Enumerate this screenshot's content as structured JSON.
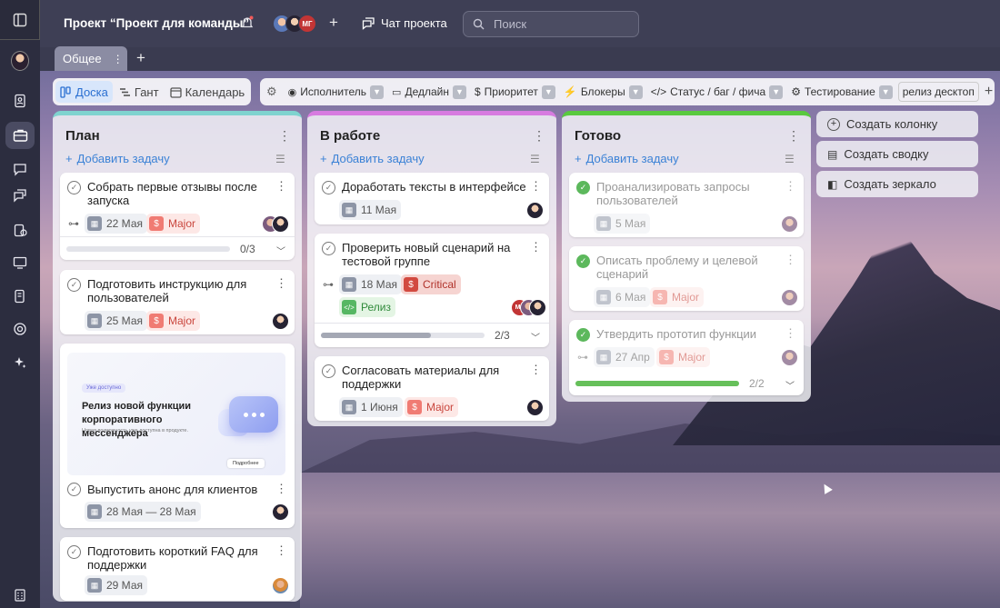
{
  "header": {
    "title": "Проект “Проект для команды”",
    "member_badge": "МГ",
    "chat_label": "Чат проекта",
    "search_placeholder": "Поиск"
  },
  "tabs": {
    "general": "Общее"
  },
  "views": [
    {
      "label": "Доска",
      "active": true
    },
    {
      "label": "Гант",
      "active": false
    },
    {
      "label": "Календарь",
      "active": false
    }
  ],
  "filters": [
    "Исполнитель",
    "Дедлайн",
    "Приоритет",
    "Блокеры",
    "Статус / баг / фича",
    "Тестирование",
    "релиз десктоп"
  ],
  "add_task_label": "Добавить задачу",
  "columns": {
    "plan": {
      "title": "План",
      "color": "#7fd3cf",
      "cards": [
        {
          "title": "Собрать первые отзывы после запуска",
          "date": "22 Мая",
          "priority": "Major",
          "progress": "0/3",
          "progress_value": 0
        },
        {
          "title": "Подготовить инструкцию для пользователей",
          "date": "25 Мая",
          "priority": "Major"
        },
        {
          "title": "Выпустить анонс для клиентов",
          "date": "28 Мая — 28 Мая",
          "image": {
            "chip": "Уже доступно",
            "heading": "Релиз новой функции корпоративного мессенджера",
            "sub": "Новая возможность уже доступна в продукте.",
            "button": "Подробнее"
          }
        },
        {
          "title": "Подготовить короткий FAQ для поддержки",
          "date": "29 Мая"
        }
      ]
    },
    "work": {
      "title": "В работе",
      "color": "#d77be0",
      "cards": [
        {
          "title": "Доработать тексты в интерфейсе",
          "date": "11 Мая"
        },
        {
          "title": "Проверить новый сценарий на тестовой группе",
          "date": "18 Мая",
          "priority": "Critical",
          "tag": "Релиз",
          "member_badge": "МГ",
          "progress": "2/3",
          "progress_value": 0.67
        },
        {
          "title": "Согласовать материалы для поддержки",
          "date": "1 Июня",
          "priority": "Major"
        }
      ]
    },
    "done": {
      "title": "Готово",
      "color": "#59c93f",
      "cards": [
        {
          "title": "Проанализировать запросы пользователей",
          "date": "5 Мая"
        },
        {
          "title": "Описать проблему и целевой сценарий",
          "date": "6 Мая",
          "priority": "Major"
        },
        {
          "title": "Утвердить прототип функции",
          "date": "27 Апр",
          "priority": "Major",
          "progress": "2/2",
          "progress_value": 1
        }
      ]
    }
  },
  "actions": {
    "create_column": "Создать колонку",
    "create_summary": "Создать сводку",
    "create_mirror": "Создать зеркало"
  }
}
